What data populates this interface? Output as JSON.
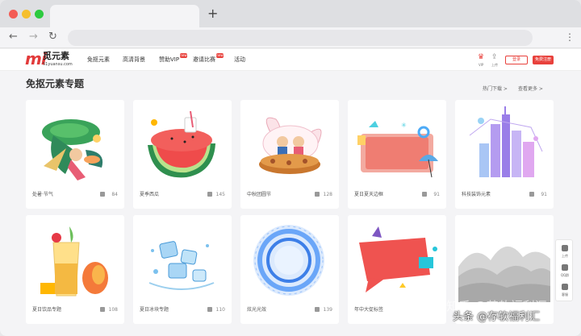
{
  "browser": {
    "new_tab_label": "+",
    "back_icon": "←",
    "forward_icon": "→",
    "reload_icon": "↻",
    "menu_icon": "⋮"
  },
  "site": {
    "logo_mark": "mi",
    "logo_name": "觅元素",
    "logo_domain": "51yuansu.com",
    "nav": [
      {
        "label": "免抠元素"
      },
      {
        "label": "高清背景"
      },
      {
        "label": "赞助VIP",
        "tag": "new"
      },
      {
        "label": "邀请比赛",
        "tag": "new"
      },
      {
        "label": "活动"
      }
    ],
    "vip_label": "VIP",
    "upload_label": "上传",
    "login_label": "登录",
    "register_label": "免费注册"
  },
  "section": {
    "title": "免抠元素专题",
    "hot_download": "热门下载 >",
    "view_more": "查看更多 >"
  },
  "cards": [
    {
      "caption": "处暑·节气",
      "count": "84"
    },
    {
      "caption": "夏季西瓜",
      "count": "145"
    },
    {
      "caption": "中秋团圆节",
      "count": "128"
    },
    {
      "caption": "夏日夏天边框",
      "count": "91"
    },
    {
      "caption": "科技装饰元素",
      "count": "91"
    },
    {
      "caption": "夏日饮品专题",
      "count": "108"
    },
    {
      "caption": "夏日冰块专题",
      "count": "110"
    },
    {
      "caption": "炫光光效",
      "count": "139"
    },
    {
      "caption": "年中大促标签",
      "count": ""
    },
    {
      "caption": "",
      "count": ""
    }
  ],
  "sidebar": {
    "items": [
      {
        "label": "上传"
      },
      {
        "label": "QQ群"
      },
      {
        "label": "客服"
      }
    ]
  },
  "watermark": {
    "line1": "知乎 @苍软福利汇",
    "line2": "头条 @存软福利汇"
  },
  "colors": {
    "brand_red": "#e8413c",
    "page_bg": "#f4f4f6"
  }
}
